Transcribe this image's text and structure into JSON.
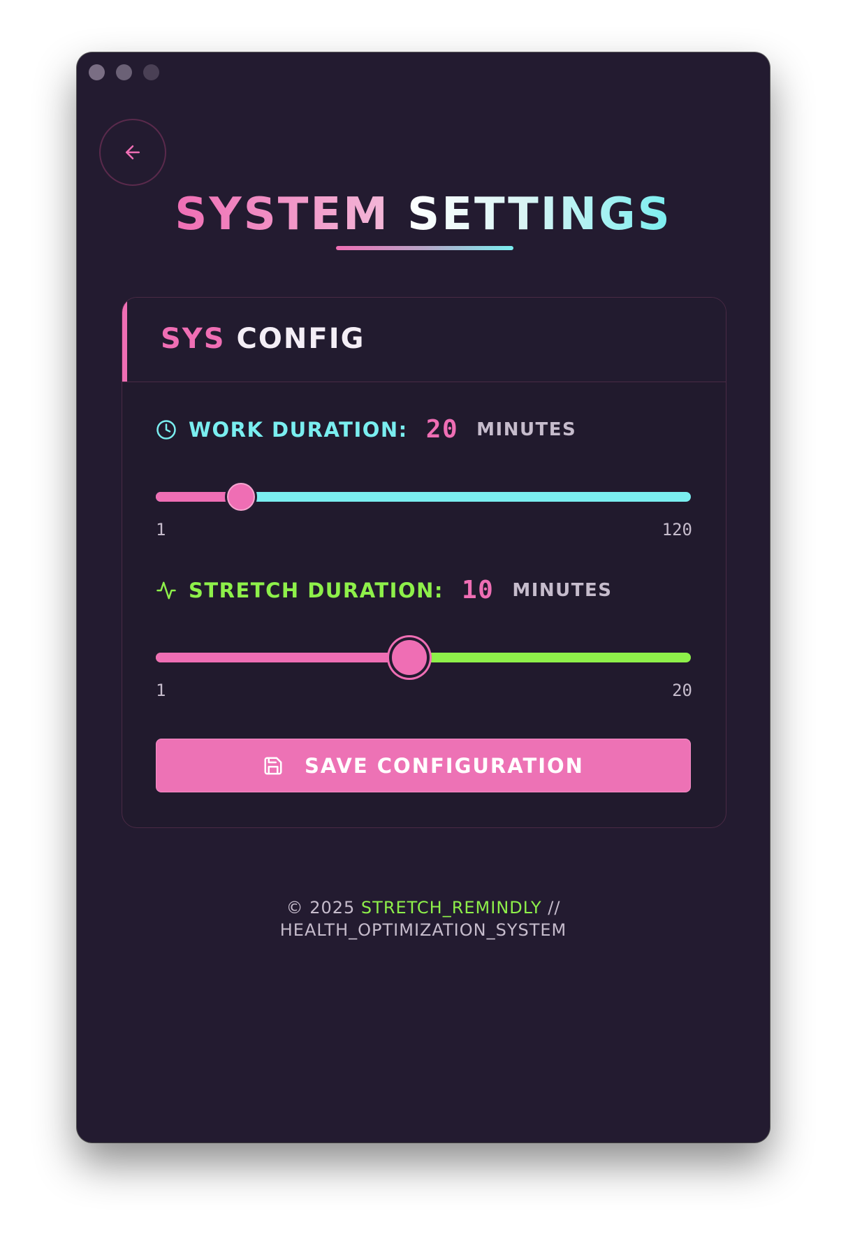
{
  "window": {
    "title": "SYSTEM SETTINGS",
    "title_part1": "SYSTEM",
    "title_part2": "SETTINGS"
  },
  "navigation": {
    "back_icon": "arrow-left-icon"
  },
  "card": {
    "title_part1": "SYS",
    "title_part2": "CONFIG"
  },
  "work": {
    "icon": "clock-icon",
    "label": "WORK DURATION:",
    "value": "20",
    "unit": "MINUTES",
    "min": "1",
    "max": "120",
    "slider_value": 20
  },
  "stretch": {
    "icon": "activity-pulse-icon",
    "label": "STRETCH DURATION:",
    "value": "10",
    "unit": "MINUTES",
    "min": "1",
    "max": "20",
    "slider_value": 10
  },
  "save_button": {
    "icon": "save-floppy-icon",
    "label": "SAVE CONFIGURATION"
  },
  "footer": {
    "copyright": "© 2025",
    "brand": "STRETCH_REMINDLY",
    "separator": "//",
    "tagline": "HEALTH_OPTIMIZATION_SYSTEM"
  },
  "colors": {
    "background": "#231b30",
    "pink_accent": "#ef6eb4",
    "cyan_accent": "#7aeef0",
    "green_accent": "#8ef04a",
    "muted_text": "#c6bccc"
  }
}
